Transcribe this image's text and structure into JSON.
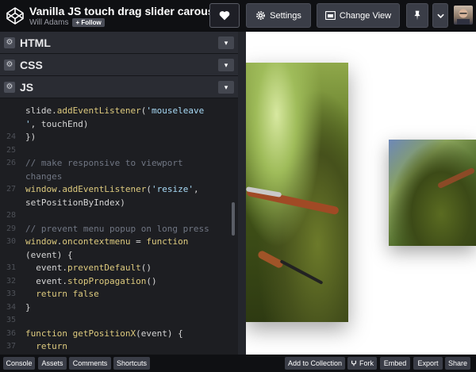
{
  "header": {
    "title": "Vanilla JS touch drag slider carousel",
    "author": "Will Adams",
    "follow_label": "+ Follow",
    "settings_label": "Settings",
    "change_view_label": "Change View"
  },
  "panels": {
    "html_label": "HTML",
    "css_label": "CSS",
    "js_label": "JS"
  },
  "code": [
    {
      "ln": "",
      "parts": [
        {
          "c": "p",
          "t": "slide."
        },
        {
          "c": "f",
          "t": "addEventListener"
        },
        {
          "c": "p",
          "t": "("
        },
        {
          "c": "s",
          "t": "'mouseleave"
        }
      ]
    },
    {
      "ln": "",
      "parts": [
        {
          "c": "s",
          "t": "'"
        },
        {
          "c": "p",
          "t": ", touchEnd)"
        }
      ]
    },
    {
      "ln": "24",
      "parts": [
        {
          "c": "p",
          "t": "})"
        }
      ]
    },
    {
      "ln": "25",
      "parts": []
    },
    {
      "ln": "26",
      "parts": [
        {
          "c": "c",
          "t": "// make responsive to viewport"
        }
      ]
    },
    {
      "ln": "",
      "parts": [
        {
          "c": "c",
          "t": "changes"
        }
      ]
    },
    {
      "ln": "27",
      "parts": [
        {
          "c": "k",
          "t": "window"
        },
        {
          "c": "p",
          "t": "."
        },
        {
          "c": "f",
          "t": "addEventListener"
        },
        {
          "c": "p",
          "t": "("
        },
        {
          "c": "s",
          "t": "'resize'"
        },
        {
          "c": "p",
          "t": ","
        }
      ]
    },
    {
      "ln": "",
      "parts": [
        {
          "c": "p",
          "t": "setPositionByIndex)"
        }
      ]
    },
    {
      "ln": "28",
      "parts": []
    },
    {
      "ln": "29",
      "parts": [
        {
          "c": "c",
          "t": "// prevent menu popup on long press"
        }
      ]
    },
    {
      "ln": "30",
      "parts": [
        {
          "c": "k",
          "t": "window"
        },
        {
          "c": "p",
          "t": "."
        },
        {
          "c": "k",
          "t": "oncontextmenu"
        },
        {
          "c": "p",
          "t": " = "
        },
        {
          "c": "kw",
          "t": "function"
        }
      ]
    },
    {
      "ln": "",
      "parts": [
        {
          "c": "p",
          "t": "(event) {"
        }
      ]
    },
    {
      "ln": "31",
      "parts": [
        {
          "c": "p",
          "t": "  event."
        },
        {
          "c": "f",
          "t": "preventDefault"
        },
        {
          "c": "p",
          "t": "()"
        }
      ]
    },
    {
      "ln": "32",
      "parts": [
        {
          "c": "p",
          "t": "  event."
        },
        {
          "c": "f",
          "t": "stopPropagation"
        },
        {
          "c": "p",
          "t": "()"
        }
      ]
    },
    {
      "ln": "33",
      "parts": [
        {
          "c": "kw",
          "t": "  return"
        },
        {
          "c": "p",
          "t": " "
        },
        {
          "c": "kw",
          "t": "false"
        }
      ]
    },
    {
      "ln": "34",
      "parts": [
        {
          "c": "p",
          "t": "}"
        }
      ]
    },
    {
      "ln": "35",
      "parts": []
    },
    {
      "ln": "36",
      "parts": [
        {
          "c": "kw",
          "t": "function"
        },
        {
          "c": "p",
          "t": " "
        },
        {
          "c": "f",
          "t": "getPositionX"
        },
        {
          "c": "p",
          "t": "(event) {"
        }
      ]
    },
    {
      "ln": "37",
      "parts": [
        {
          "c": "kw",
          "t": "  return"
        }
      ]
    }
  ],
  "footer": {
    "left": [
      "Console",
      "Assets",
      "Comments",
      "Shortcuts"
    ],
    "right": [
      "Add to Collection",
      "Fork",
      "Embed",
      "Export",
      "Share"
    ]
  }
}
